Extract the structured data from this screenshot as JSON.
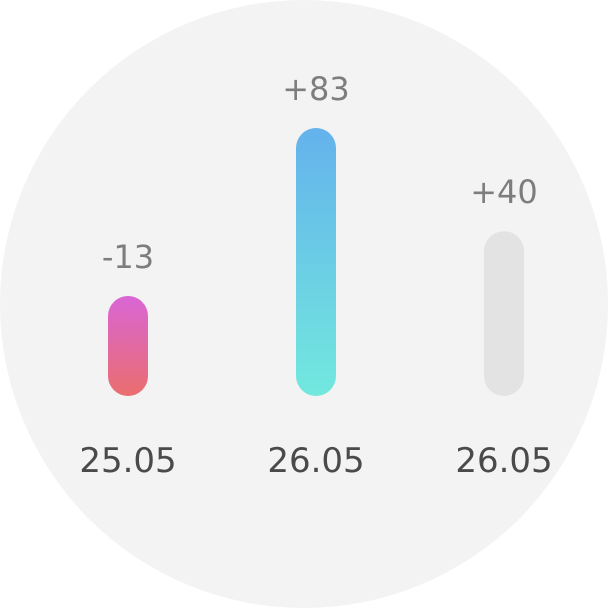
{
  "chart_data": {
    "type": "bar",
    "categories": [
      "25.05",
      "26.05",
      "26.05"
    ],
    "values": [
      -13,
      83,
      40
    ],
    "value_labels": [
      "-13",
      "+83",
      "+40"
    ],
    "bar_colors": [
      {
        "top": "#d966d6",
        "bottom": "#ea6e6e"
      },
      {
        "top": "#64b2ec",
        "bottom": "#72e8de"
      },
      {
        "top": "#e3e3e3",
        "bottom": "#e3e3e3"
      }
    ],
    "title": "",
    "xlabel": "",
    "ylabel": "",
    "grid": false,
    "legend": "none"
  },
  "colors": {
    "background": "#f3f3f3",
    "value_text": "#7d7d7d",
    "date_text": "#4a4a4a"
  }
}
